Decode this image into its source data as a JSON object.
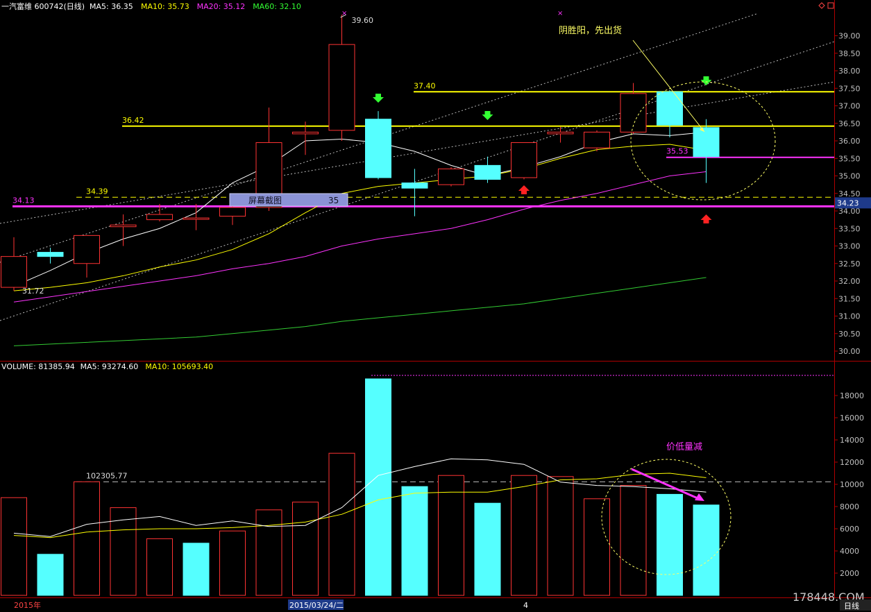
{
  "header": {
    "title": "一汽富维",
    "code": "600742",
    "period": "(日线)",
    "ma_items": [
      {
        "label": "MA5: 36.35",
        "color": "#ffffff"
      },
      {
        "label": "MA10: 35.73",
        "color": "#ffff00"
      },
      {
        "label": "MA20: 35.12",
        "color": "#ff33ff"
      },
      {
        "label": "MA60: 32.10",
        "color": "#33ff33"
      }
    ]
  },
  "volume_header": {
    "items": [
      {
        "label": "VOLUME: 81385.94",
        "color": "#ffffff"
      },
      {
        "label": "MA5: 93274.60",
        "color": "#ffffff"
      },
      {
        "label": "MA10: 105693.40",
        "color": "#ffff00"
      }
    ]
  },
  "colors": {
    "up": "#ff3333",
    "down": "#55ffff",
    "ma5": "#ffffff",
    "ma10": "#ffff00",
    "ma20": "#ff33ff",
    "ma60": "#33cc33",
    "grid_border": "#b00000",
    "axis_text": "#c0c0c0"
  },
  "annotations": {
    "high_label": "39.60",
    "low_label": "31.72",
    "line_3742": "37.40",
    "line_3642": "36.42",
    "line_3439": "34.39",
    "line_3413": "34.13",
    "line_3553": "35.53",
    "current_price": "34.23",
    "note_price": "阴胜阳，先出货",
    "note_volume": "价低量减",
    "vol_ref": "102305.77",
    "popup_label": "屏幕截图",
    "popup_value": "35"
  },
  "bottom_axis": {
    "year": "2015年",
    "selected_date": "2015/03/24/二",
    "month_mark": "4",
    "period_label": "日线",
    "watermark": "178448.COM"
  },
  "corner_icons": [
    "restore-icon",
    "close-icon"
  ],
  "chart_data": [
    {
      "type": "candlestick",
      "title": "一汽富维 600742(日线)",
      "ylim": [
        29.8,
        39.5
      ],
      "y_ticks": [
        30.0,
        30.5,
        31.0,
        31.5,
        32.0,
        32.5,
        33.0,
        33.5,
        34.0,
        34.5,
        35.0,
        35.5,
        36.0,
        36.5,
        37.0,
        37.5,
        38.0,
        38.5,
        39.0
      ],
      "candles": [
        {
          "open": 31.82,
          "close": 32.7,
          "high": 33.25,
          "low": 31.72
        },
        {
          "open": 32.82,
          "close": 32.7,
          "high": 32.95,
          "low": 32.5
        },
        {
          "open": 32.5,
          "close": 33.3,
          "high": 33.3,
          "low": 32.1
        },
        {
          "open": 33.55,
          "close": 33.6,
          "high": 33.9,
          "low": 33.0
        },
        {
          "open": 33.75,
          "close": 33.9,
          "high": 34.2,
          "low": 33.7
        },
        {
          "open": 33.8,
          "close": 33.8,
          "high": 34.2,
          "low": 33.45
        },
        {
          "open": 33.85,
          "close": 34.1,
          "high": 34.4,
          "low": 33.6
        },
        {
          "open": 34.1,
          "close": 35.95,
          "high": 36.95,
          "low": 34.0
        },
        {
          "open": 36.2,
          "close": 36.25,
          "high": 36.55,
          "low": 35.6
        },
        {
          "open": 36.3,
          "close": 38.75,
          "high": 39.6,
          "low": 36.0
        },
        {
          "open": 36.62,
          "close": 34.95,
          "high": 36.85,
          "low": 34.9
        },
        {
          "open": 34.8,
          "close": 34.65,
          "high": 35.2,
          "low": 33.85
        },
        {
          "open": 34.75,
          "close": 35.2,
          "high": 35.25,
          "low": 34.7
        },
        {
          "open": 35.3,
          "close": 34.9,
          "high": 35.55,
          "low": 34.8
        },
        {
          "open": 34.95,
          "close": 35.95,
          "high": 35.95,
          "low": 34.9
        },
        {
          "open": 36.2,
          "close": 36.25,
          "high": 36.4,
          "low": 35.95
        },
        {
          "open": 35.8,
          "close": 36.25,
          "high": 36.3,
          "low": 35.7
        },
        {
          "open": 36.25,
          "close": 37.35,
          "high": 37.65,
          "low": 36.2
        },
        {
          "open": 37.4,
          "close": 36.45,
          "high": 37.45,
          "low": 36.1
        },
        {
          "open": 36.38,
          "close": 35.55,
          "high": 36.62,
          "low": 34.8
        }
      ],
      "ma5": [
        31.85,
        32.3,
        32.8,
        33.2,
        33.5,
        33.95,
        34.8,
        35.3,
        36.0,
        36.05,
        35.95,
        35.7,
        35.3,
        35.0,
        35.25,
        35.55,
        35.95,
        36.2,
        36.15,
        36.25
      ],
      "ma10": [
        31.72,
        31.82,
        31.95,
        32.15,
        32.4,
        32.6,
        32.9,
        33.35,
        33.95,
        34.5,
        34.7,
        34.8,
        34.9,
        35.0,
        35.2,
        35.5,
        35.75,
        35.85,
        35.9,
        35.73
      ],
      "ma20": [
        31.4,
        31.55,
        31.7,
        31.85,
        32.0,
        32.15,
        32.35,
        32.5,
        32.7,
        33.0,
        33.2,
        33.35,
        33.5,
        33.75,
        34.05,
        34.3,
        34.5,
        34.75,
        35.0,
        35.12
      ],
      "ma60": [
        30.15,
        30.2,
        30.25,
        30.3,
        30.35,
        30.4,
        30.5,
        30.6,
        30.7,
        30.85,
        30.95,
        31.05,
        31.15,
        31.25,
        31.35,
        31.5,
        31.65,
        31.8,
        31.95,
        32.1
      ],
      "horizontal_levels": [
        37.4,
        36.42,
        34.39,
        34.13,
        35.53
      ]
    },
    {
      "type": "bar",
      "title": "VOLUME",
      "ylim": [
        0,
        19500
      ],
      "y_ticks": [
        2000,
        4000,
        6000,
        8000,
        10000,
        12000,
        14000,
        16000,
        18000
      ],
      "values": [
        8800,
        3700,
        10230,
        7900,
        5100,
        4700,
        5800,
        7700,
        8400,
        12800,
        19500,
        9800,
        10800,
        8300,
        10800,
        10700,
        8700,
        9900,
        9100,
        8140
      ],
      "up": [
        true,
        false,
        true,
        true,
        true,
        false,
        true,
        true,
        true,
        true,
        false,
        false,
        true,
        false,
        true,
        true,
        true,
        true,
        false,
        false
      ],
      "ma5": [
        5600,
        5300,
        6400,
        6800,
        7100,
        6300,
        6700,
        6200,
        6300,
        7900,
        10800,
        11600,
        12300,
        12200,
        11800,
        10200,
        9900,
        9800,
        9600,
        9300
      ],
      "ma10": [
        5400,
        5200,
        5700,
        5900,
        6000,
        6000,
        6100,
        6300,
        6600,
        7300,
        8600,
        9200,
        9300,
        9300,
        9800,
        10400,
        10500,
        10900,
        11000,
        10600
      ]
    }
  ]
}
